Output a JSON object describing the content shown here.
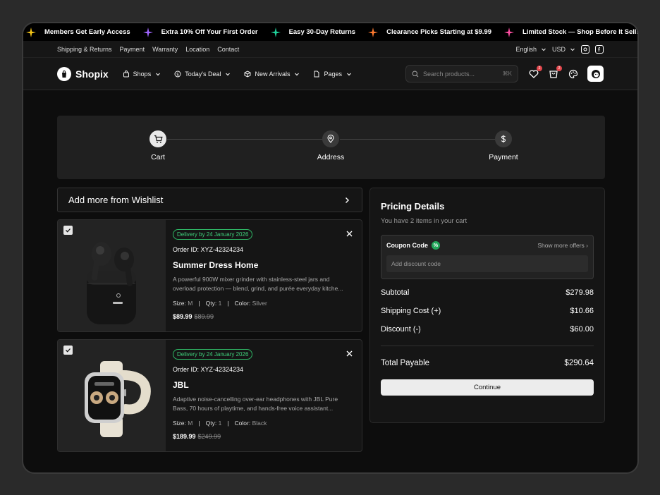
{
  "ticker": {
    "messages": [
      "Members Get Early Access",
      "Extra 10% Off Your First Order",
      "Easy 30-Day Returns",
      "Clearance Picks Starting at $9.99",
      "Limited Stock — Shop Before It Sells Out"
    ],
    "star_colors": [
      "#f5c518",
      "#a066ff",
      "#1fd19a",
      "#ff7a2f",
      "#ff4fa3"
    ]
  },
  "util": {
    "links": [
      "Shipping & Returns",
      "Payment",
      "Warranty",
      "Location",
      "Contact"
    ],
    "language": "English",
    "currency": "USD"
  },
  "nav": {
    "brand": "Shopix",
    "items": [
      "Shops",
      "Today's Deal",
      "New Arrivals",
      "Pages"
    ],
    "search_placeholder": "Search products...",
    "search_shortcut": "⌘K",
    "wishlist_count": "2",
    "cart_count": "2"
  },
  "steps": [
    "Cart",
    "Address",
    "Payment"
  ],
  "wishlist_label": "Add more from Wishlist",
  "products": [
    {
      "delivery": "Delivery by 24 January 2026",
      "order_id": "Order ID: XYZ-42324234",
      "name": "Summer Dress Home",
      "description": "A powerful 900W mixer grinder with stainless-steel jars and overload protection — blend, grind, and purée everyday kitche...",
      "size_label": "Size:",
      "size": "M",
      "qty_label": "Qty:",
      "qty": "1",
      "color_label": "Color:",
      "color": "Silver",
      "price": "$89.99",
      "old_price": "$89.99"
    },
    {
      "delivery": "Delivery by 24 January 2026",
      "order_id": "Order ID: XYZ-42324234",
      "name": "JBL",
      "description": "Adaptive noise-cancelling over-ear headphones with JBL Pure Bass, 70 hours of playtime, and hands-free voice assistant...",
      "size_label": "Size:",
      "size": "M",
      "qty_label": "Qty:",
      "qty": "1",
      "color_label": "Color:",
      "color": "Black",
      "price": "$189.99",
      "old_price": "$249.99"
    }
  ],
  "pricing": {
    "title": "Pricing Details",
    "subtitle": "You have 2 items in your cart",
    "coupon_label": "Coupon Code",
    "coupon_badge": "%",
    "show_offers": "Show more offers",
    "coupon_placeholder": "Add discount code",
    "rows": [
      {
        "label": "Subtotal",
        "amount": "$279.98"
      },
      {
        "label": "Shipping Cost (+)",
        "amount": "$10.66"
      },
      {
        "label": "Discount (-)",
        "amount": "$60.00"
      }
    ],
    "total_label": "Total Payable",
    "total_amount": "$290.64",
    "continue_label": "Continue"
  }
}
